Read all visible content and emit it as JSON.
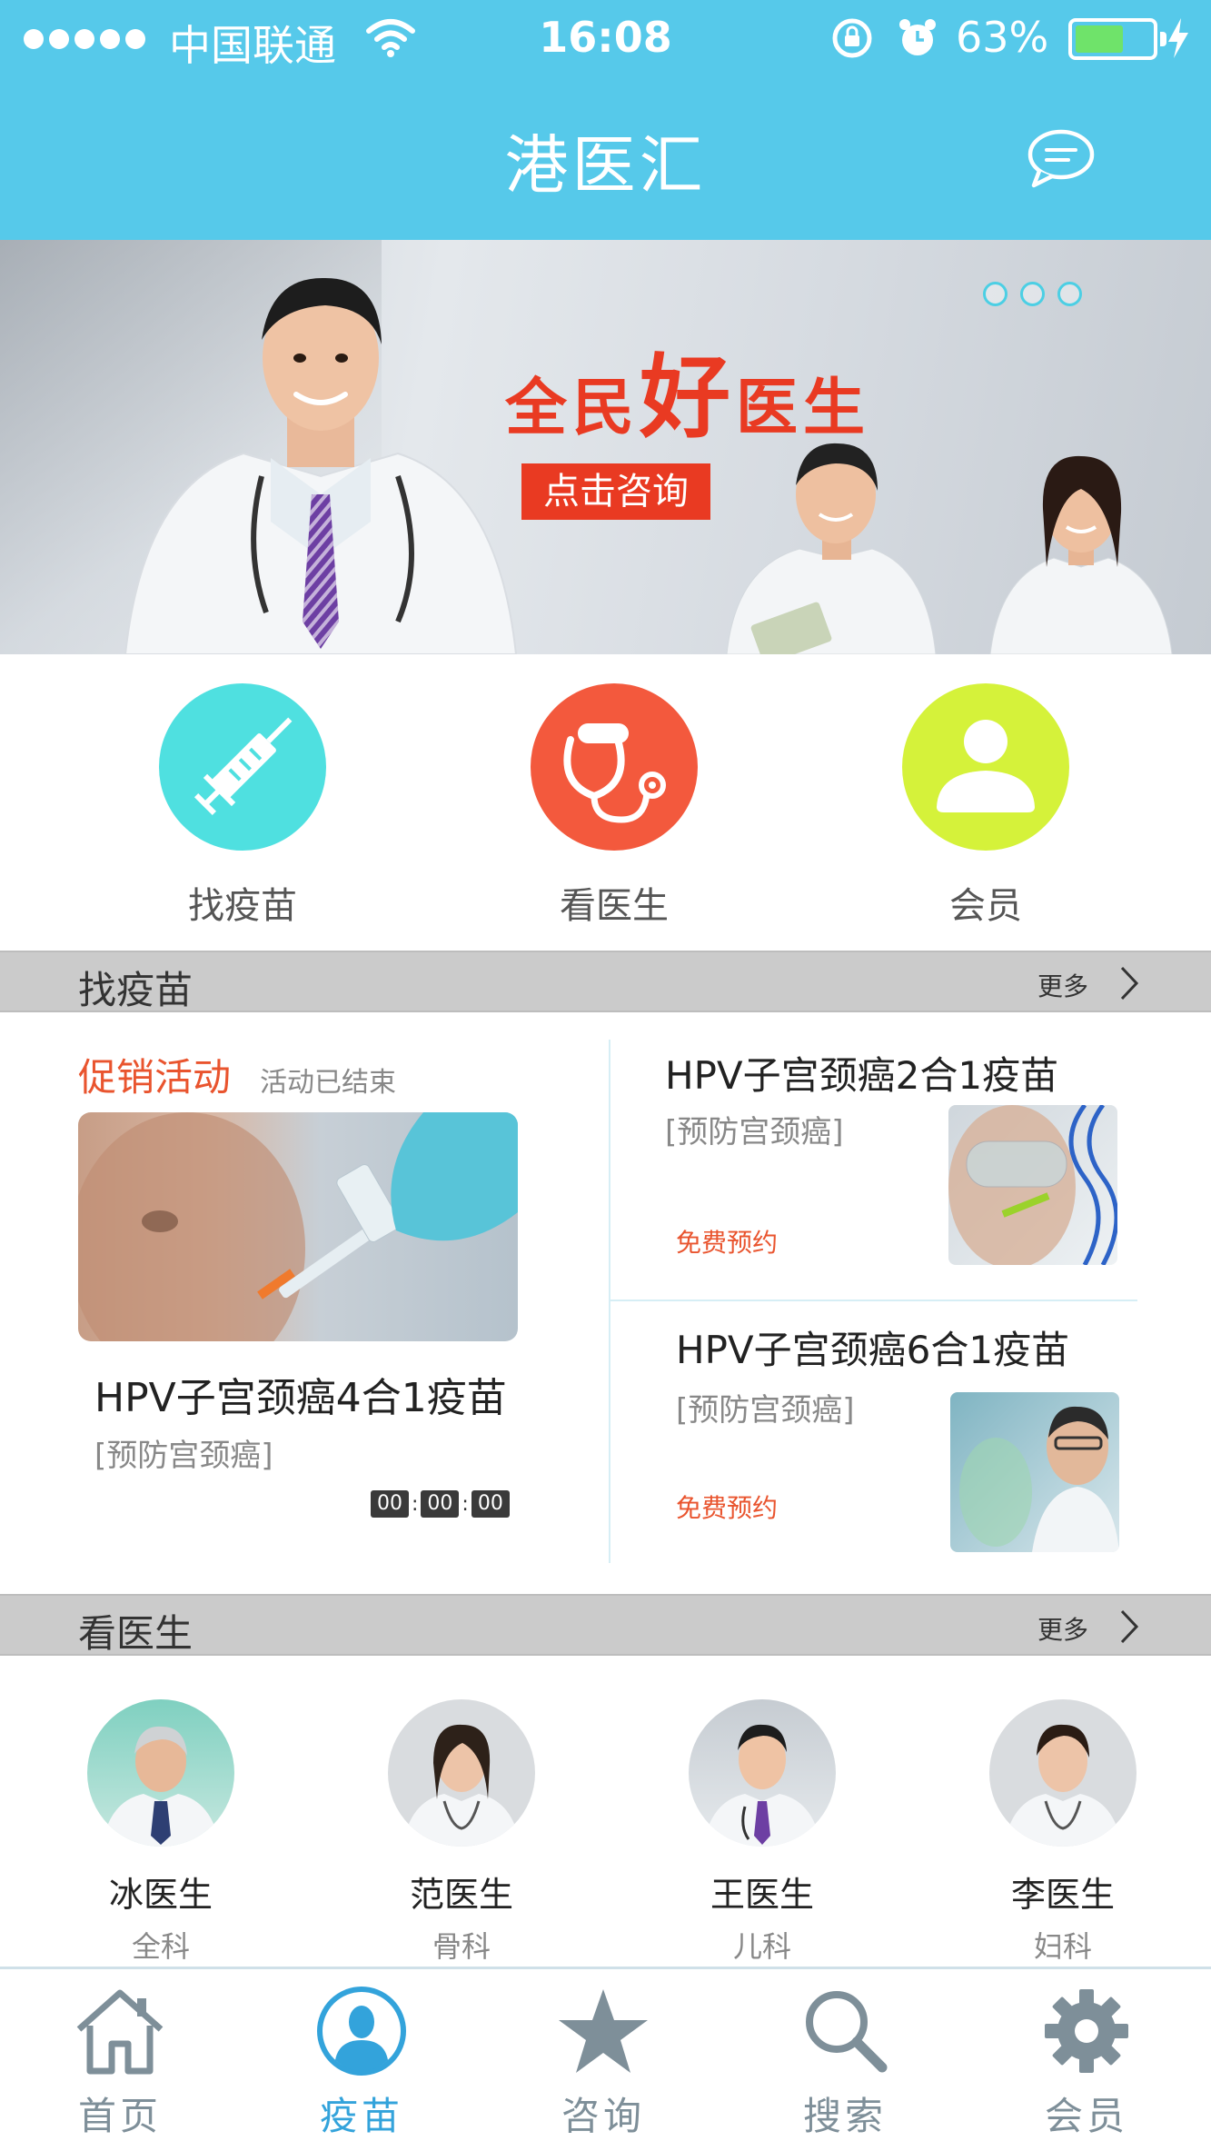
{
  "status_bar": {
    "carrier": "中国联通",
    "time": "16:08",
    "battery": "63%",
    "battery_level": 0.63
  },
  "header": {
    "title": "港医汇",
    "chat_icon": "chat-bubble-icon"
  },
  "banner": {
    "headline_a": "全民",
    "headline_b": "好",
    "headline_c": "医生",
    "button": "点击咨询",
    "slide_count": 3
  },
  "quick_entries": [
    {
      "label": "找疫苗",
      "icon": "syringe-icon",
      "color": "#4fe0e0"
    },
    {
      "label": "看医生",
      "icon": "stethoscope-icon",
      "color": "#f3593d"
    },
    {
      "label": "会员",
      "icon": "user-icon",
      "color": "#d5f23a"
    }
  ],
  "vaccine_section": {
    "title": "找疫苗",
    "more": "更多",
    "promo": {
      "tag": "促销活动",
      "status": "活动已结束",
      "name": "HPV子宫颈癌4合1疫苗",
      "subtitle": "[预防宫颈癌]",
      "timer": [
        "00",
        "00",
        "00"
      ]
    },
    "items": [
      {
        "name": "HPV子宫颈癌2合1疫苗",
        "subtitle": "[预防宫颈癌]",
        "cta": "免费预约"
      },
      {
        "name": "HPV子宫颈癌6合1疫苗",
        "subtitle": "[预防宫颈癌]",
        "cta": "免费预约"
      }
    ]
  },
  "doctor_section": {
    "title": "看医生",
    "more": "更多",
    "doctors": [
      {
        "name": "冰医生",
        "dept": "全科"
      },
      {
        "name": "范医生",
        "dept": "骨科"
      },
      {
        "name": "王医生",
        "dept": "儿科"
      },
      {
        "name": "李医生",
        "dept": "妇科"
      }
    ]
  },
  "tabbar": {
    "active": 1,
    "tabs": [
      {
        "label": "首页",
        "icon": "home-icon"
      },
      {
        "label": "疫苗",
        "icon": "person-icon"
      },
      {
        "label": "咨询",
        "icon": "star-icon"
      },
      {
        "label": "搜索",
        "icon": "search-icon"
      },
      {
        "label": "会员",
        "icon": "gear-icon"
      }
    ],
    "active_color": "#33a3db",
    "inactive_color": "#7e8f99"
  }
}
